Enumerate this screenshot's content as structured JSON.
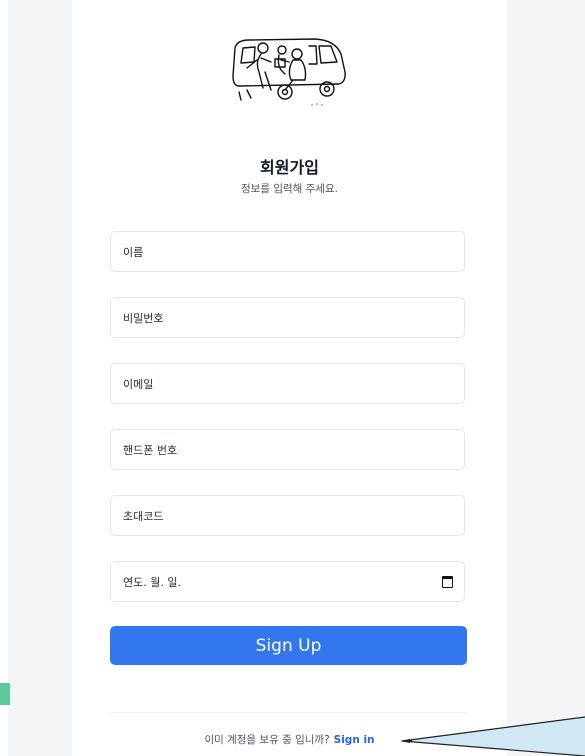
{
  "signup": {
    "title": "회원가입",
    "subtitle": "정보를 입력해 주세요.",
    "fields": [
      {
        "label": "이름"
      },
      {
        "label": "비밀번호"
      },
      {
        "label": "이메일"
      },
      {
        "label": "핸드폰 번호"
      },
      {
        "label": "초대코드"
      },
      {
        "label": "연도. 월. 일."
      }
    ],
    "button_label": "Sign Up",
    "footer_text": "이미 계정을 보유 중 입니까?",
    "footer_link": "Sign in"
  },
  "colors": {
    "primary": "#3377ee",
    "link": "#2563eb",
    "background": "#f3f4f6",
    "annotation_arrow": "#222222",
    "annotation_fill": "#cfe8f3",
    "green_mark": "#5ec9a0"
  },
  "icons": {
    "illustration": "van-people-illustration",
    "date": "calendar-icon"
  }
}
